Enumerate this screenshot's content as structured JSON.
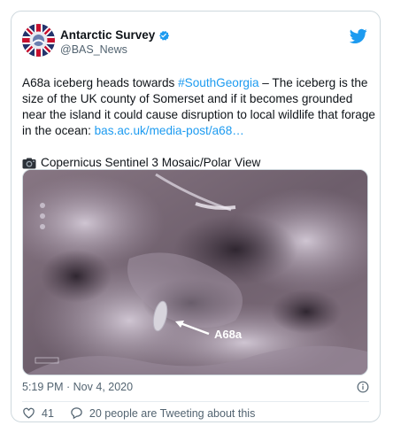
{
  "tweet": {
    "display_name": "Antarctic Survey",
    "handle": "@BAS_News",
    "text_pre_link": "A68a iceberg heads towards ",
    "hashtag": "#SouthGeorgia",
    "text_post_link": " – The iceberg is the size of the UK county of Somerset and if it becomes grounded near the island it could cause disruption to local wildlife that forage in the ocean:  ",
    "url": "bas.ac.uk/media-post/a68…",
    "caption": "Copernicus Sentinel 3 Mosaic/Polar View",
    "timestamp": "5:19 PM · Nov 4, 2020",
    "image_label": "A68a"
  },
  "actions": {
    "likes": "41",
    "tweeting": "20 people are Tweeting about this"
  },
  "colors": {
    "link": "#1d9bf0",
    "verified": "#1d9bf0",
    "twitter_bird": "#1d9bf0",
    "text": "#0f1419",
    "secondary": "#536471"
  },
  "icons": [
    "avatar-logo",
    "verified-badge-icon",
    "twitter-bird-icon",
    "camera-icon",
    "info-icon",
    "heart-icon",
    "reply-bubble-icon"
  ]
}
